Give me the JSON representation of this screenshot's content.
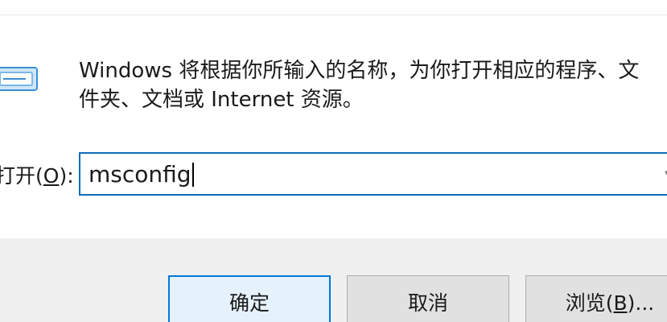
{
  "dialog": {
    "description": "Windows 将根据你所输入的名称，为你打开相应的程序、文件夹、文档或 Internet 资源。",
    "description_line1": "Windows 将根据你所输入的名称，为你打开相应的程序、文",
    "description_line2": "件夹、文档或 Internet 资源。",
    "open_label_prefix": "打开(",
    "open_label_accel": "O",
    "open_label_suffix": "):",
    "command_value": "msconfig",
    "icon": "run-program-icon",
    "dropdown_icon": "chevron-down-icon"
  },
  "buttons": {
    "ok_label": "确定",
    "cancel_label": "取消",
    "browse_prefix": "浏览(",
    "browse_accel": "B",
    "browse_suffix": ")..."
  },
  "colors": {
    "focus_border": "#0f6cbd",
    "default_button_border": "#0078d7",
    "button_bar_background": "#f0f0f0"
  }
}
